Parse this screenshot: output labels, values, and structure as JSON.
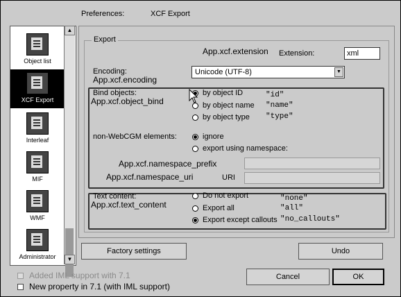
{
  "header": {
    "preferences_label": "Preferences:",
    "section_label": "XCF Export"
  },
  "sidebar": {
    "items": [
      {
        "label": "Object list",
        "selected": false
      },
      {
        "label": "XCF Export",
        "selected": true
      },
      {
        "label": "Interleaf",
        "selected": false
      },
      {
        "label": "MIF",
        "selected": false
      },
      {
        "label": "WMF",
        "selected": false
      },
      {
        "label": "Administrator",
        "selected": false
      }
    ]
  },
  "export": {
    "group_title": "Export",
    "extension_key": "App.xcf.extension",
    "extension_label": "Extension:",
    "extension_value": "xml",
    "encoding_label": "Encoding:",
    "encoding_key": "App.xcf.encoding",
    "encoding_value": "Unicode (UTF-8)",
    "bind_label": "Bind objects:",
    "bind_key": "App.xcf.object_bind",
    "bind_options": [
      {
        "label": "by object ID",
        "value": "\"id\"",
        "checked": true
      },
      {
        "label": "by object name",
        "value": "\"name\"",
        "checked": false
      },
      {
        "label": "by object type",
        "value": "\"type\"",
        "checked": false
      }
    ],
    "nonwebcgm_label": "non-WebCGM elements:",
    "nonwebcgm_options": [
      {
        "label": "ignore",
        "checked": true
      },
      {
        "label": "export using namespace:",
        "checked": false
      }
    ],
    "ns_prefix_key": "App.xcf.namespace_prefix",
    "ns_uri_key": "App.xcf.namespace_uri",
    "ns_uri_label": "URI",
    "text_label": "Text content:",
    "text_key": "App.xcf.text_content",
    "text_options": [
      {
        "label": "Do not export",
        "value": "\"none\"",
        "checked": false
      },
      {
        "label": "Export all",
        "value": "\"all\"",
        "checked": false
      },
      {
        "label": "Export except callouts",
        "value": "\"no_callouts\"",
        "checked": true
      }
    ]
  },
  "buttons": {
    "factory": "Factory settings",
    "undo": "Undo",
    "cancel": "Cancel",
    "ok": "OK"
  },
  "legend": [
    {
      "label": "Added IML support with 7.1",
      "disabled": true
    },
    {
      "label": "New property in 7.1 (with IML support)",
      "disabled": false
    }
  ]
}
